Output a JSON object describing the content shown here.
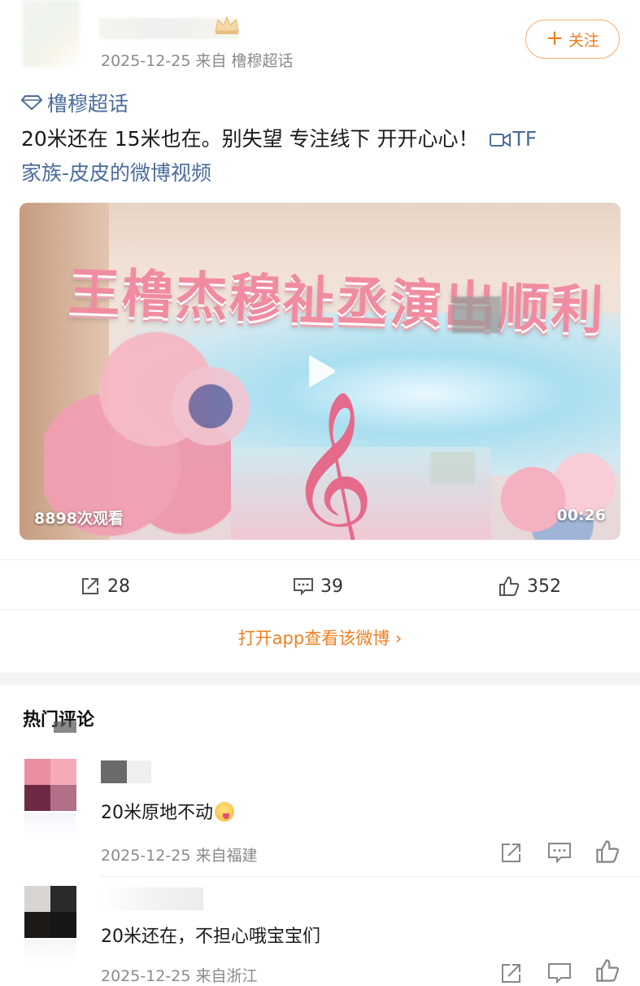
{
  "post": {
    "meta": "2025-12-25 来自 橹穆超话",
    "follow_label": "关注",
    "topic": "橹穆超话",
    "text_main": "20米还在 15米也在。别失望 专注线下 开开心心！",
    "text_link_a": "TF",
    "text_link_b": "家族-皮皮的微博视频"
  },
  "video": {
    "banner_text": "王橹杰穆祉丞演出顺利",
    "views": "8898次观看",
    "duration": "00:26"
  },
  "actions": {
    "share_count": "28",
    "comment_count": "39",
    "like_count": "352"
  },
  "open_app_label": "打开app查看该微博 ›",
  "hot_comments": {
    "title": "热门评论",
    "items": [
      {
        "text": "20米原地不动",
        "meta": "2025-12-25 来自福建"
      },
      {
        "text": "20米还在，不担心哦宝宝们",
        "meta": "2025-12-25 来自浙江"
      }
    ]
  },
  "colors": {
    "accent_orange": "#ef8024",
    "link_blue": "#4b6d9c",
    "meta_gray": "#8a8a8a"
  },
  "icons": [
    "crown-icon",
    "plus-icon",
    "diamond-topic-icon",
    "video-camera-icon",
    "play-icon",
    "share-icon",
    "comment-icon",
    "like-icon"
  ]
}
